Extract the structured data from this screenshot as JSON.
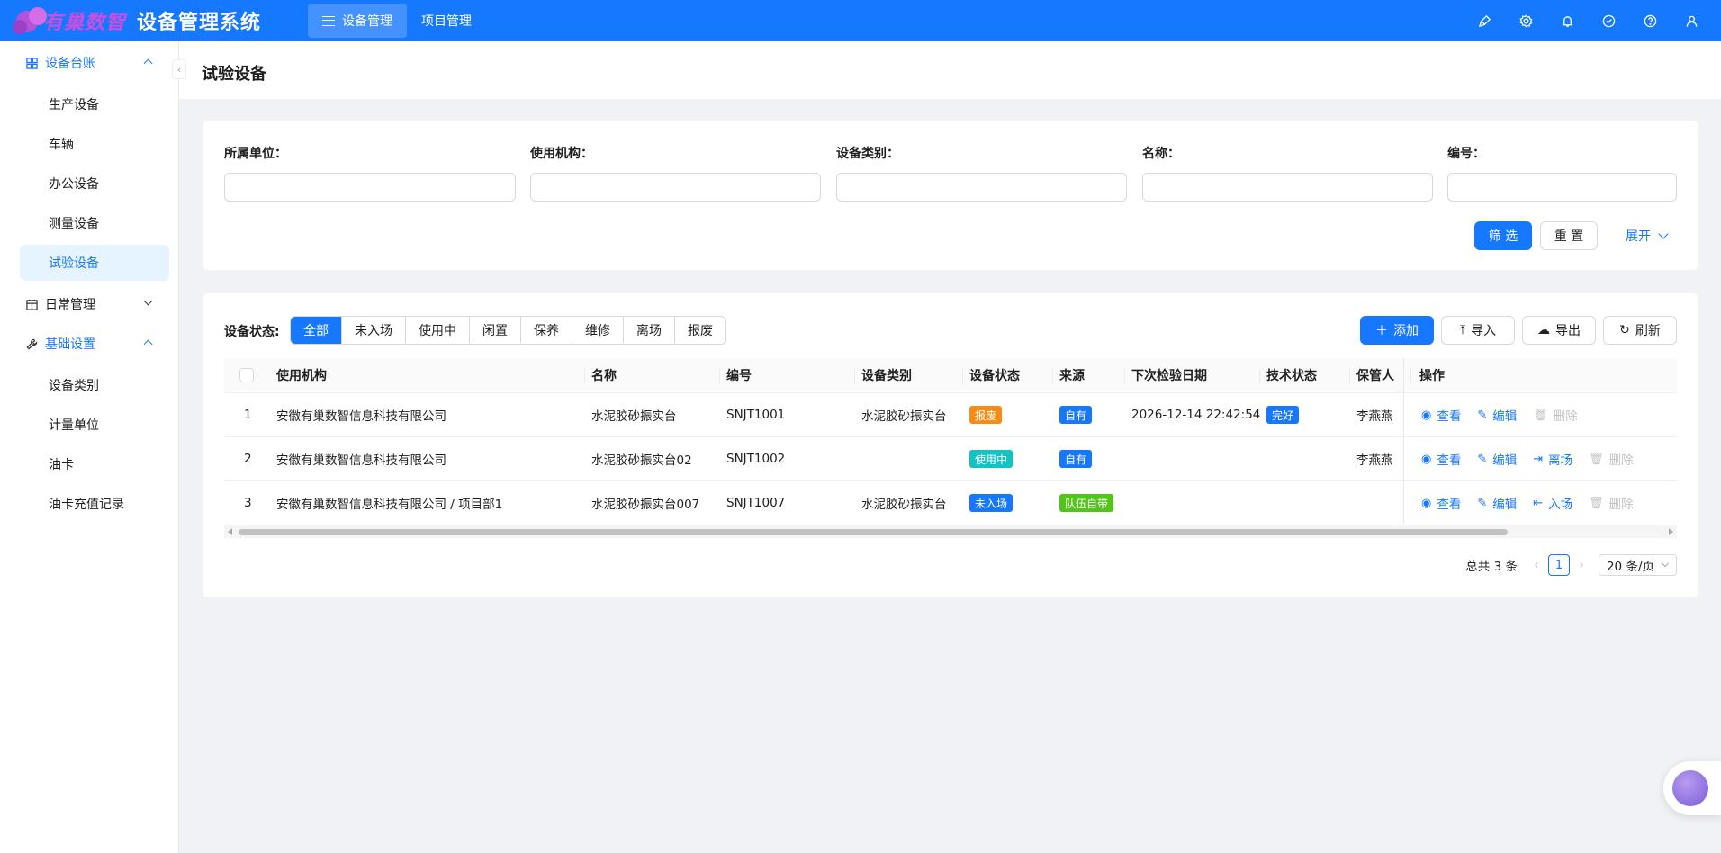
{
  "app": {
    "brand": "有巢数智",
    "title": "设备管理系统",
    "nav": [
      {
        "label": "设备管理",
        "active": true
      },
      {
        "label": "项目管理",
        "active": false
      }
    ],
    "header_icons": [
      "brush-icon",
      "settings-icon",
      "bell-icon",
      "check-circle-icon",
      "help-icon",
      "user-icon"
    ]
  },
  "sidebar": {
    "collapse_glyph": "‹",
    "groups": [
      {
        "label": "设备台账",
        "open": true,
        "icon": "grid-icon",
        "items": [
          {
            "label": "生产设备",
            "active": false
          },
          {
            "label": "车辆",
            "active": false
          },
          {
            "label": "办公设备",
            "active": false
          },
          {
            "label": "测量设备",
            "active": false
          },
          {
            "label": "试验设备",
            "active": true
          }
        ]
      },
      {
        "label": "日常管理",
        "open": false,
        "icon": "calendar-icon",
        "items": []
      },
      {
        "label": "基础设置",
        "open": true,
        "icon": "wrench-icon",
        "items": [
          {
            "label": "设备类别",
            "active": false
          },
          {
            "label": "计量单位",
            "active": false
          },
          {
            "label": "油卡",
            "active": false
          },
          {
            "label": "油卡充值记录",
            "active": false
          }
        ]
      }
    ]
  },
  "page": {
    "title": "试验设备"
  },
  "filters": {
    "fields": [
      {
        "label": "所属单位：",
        "value": "",
        "type": "select"
      },
      {
        "label": "使用机构：",
        "value": "",
        "type": "select"
      },
      {
        "label": "设备类别：",
        "value": "",
        "type": "select"
      },
      {
        "label": "名称：",
        "value": "",
        "type": "input"
      },
      {
        "label": "编号：",
        "value": "",
        "type": "input"
      }
    ],
    "search_label": "筛 选",
    "reset_label": "重 置",
    "expand_label": "展开"
  },
  "toolbar": {
    "status_label": "设备状态:",
    "statuses": [
      {
        "label": "全部",
        "active": true
      },
      {
        "label": "未入场",
        "active": false
      },
      {
        "label": "使用中",
        "active": false
      },
      {
        "label": "闲置",
        "active": false
      },
      {
        "label": "保养",
        "active": false
      },
      {
        "label": "维修",
        "active": false
      },
      {
        "label": "离场",
        "active": false
      },
      {
        "label": "报废",
        "active": false
      }
    ],
    "add_label": "添加",
    "import_label": "导入",
    "export_label": "导出",
    "refresh_label": "刷新"
  },
  "table": {
    "columns": [
      "使用机构",
      "名称",
      "编号",
      "设备类别",
      "设备状态",
      "来源",
      "下次检验日期",
      "技术状态",
      "保管人",
      "操作"
    ],
    "rows": [
      {
        "no": "1",
        "org": "安徽有巢数智信息科技有限公司",
        "name": "水泥胶砂振实台",
        "code": "SNJT1001",
        "category": "水泥胶砂振实台",
        "status": {
          "label": "报废",
          "color": "#fa8c16"
        },
        "source": {
          "label": "自有",
          "color": "#1677ff"
        },
        "next_check": "2026-12-14 22:42:54",
        "tech": {
          "label": "完好",
          "color": "#1677ff"
        },
        "keeper": "李燕燕",
        "actions": [
          {
            "label": "查看",
            "icon": "eye-icon",
            "enabled": true
          },
          {
            "label": "编辑",
            "icon": "edit-icon",
            "enabled": true
          },
          {
            "label": "删除",
            "icon": "trash-icon",
            "enabled": false
          }
        ]
      },
      {
        "no": "2",
        "org": "安徽有巢数智信息科技有限公司",
        "name": "水泥胶砂振实台02",
        "code": "SNJT1002",
        "category": "",
        "status": {
          "label": "使用中",
          "color": "#13c2c2"
        },
        "source": {
          "label": "自有",
          "color": "#1677ff"
        },
        "next_check": "",
        "tech": null,
        "keeper": "李燕燕",
        "actions": [
          {
            "label": "查看",
            "icon": "eye-icon",
            "enabled": true
          },
          {
            "label": "编辑",
            "icon": "edit-icon",
            "enabled": true
          },
          {
            "label": "离场",
            "icon": "exit-icon",
            "enabled": true
          },
          {
            "label": "删除",
            "icon": "trash-icon",
            "enabled": false
          }
        ]
      },
      {
        "no": "3",
        "org": "安徽有巢数智信息科技有限公司 / 项目部1",
        "name": "水泥胶砂振实台007",
        "code": "SNJT1007",
        "category": "水泥胶砂振实台",
        "status": {
          "label": "未入场",
          "color": "#1677ff"
        },
        "source": {
          "label": "队伍自带",
          "color": "#52c41a"
        },
        "next_check": "",
        "tech": null,
        "keeper": "",
        "actions": [
          {
            "label": "查看",
            "icon": "eye-icon",
            "enabled": true
          },
          {
            "label": "编辑",
            "icon": "edit-icon",
            "enabled": true
          },
          {
            "label": "入场",
            "icon": "enter-icon",
            "enabled": true
          },
          {
            "label": "删除",
            "icon": "trash-icon",
            "enabled": false
          }
        ]
      }
    ]
  },
  "pagination": {
    "total_label": "总共 3 条",
    "current_page": "1",
    "page_size_label": "20 条/页"
  }
}
